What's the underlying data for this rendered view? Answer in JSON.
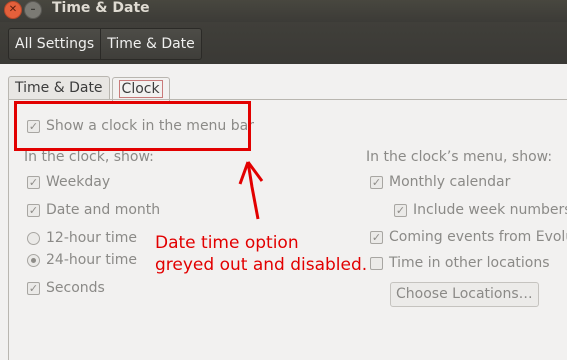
{
  "window": {
    "title": "Time & Date"
  },
  "breadcrumbs": [
    {
      "label": "All Settings"
    },
    {
      "label": "Time & Date"
    }
  ],
  "tabs": [
    {
      "label": "Time & Date"
    },
    {
      "label": "Clock"
    }
  ],
  "clock": {
    "show_clock": {
      "label": "Show a clock in the menu bar",
      "checked": true
    },
    "left_header": "In the clock, show:",
    "weekday": {
      "label": "Weekday",
      "checked": true
    },
    "date_month": {
      "label": "Date and month",
      "checked": true
    },
    "h12": {
      "label": "12-hour time",
      "selected": false
    },
    "h24": {
      "label": "24-hour time",
      "selected": true
    },
    "seconds": {
      "label": "Seconds",
      "checked": true
    },
    "right_header": "In the clock’s menu, show:",
    "monthly_calendar": {
      "label": "Monthly calendar",
      "checked": true
    },
    "week_numbers": {
      "label": "Include week numbers",
      "checked": true
    },
    "coming_events": {
      "label": "Coming events from Evolut",
      "checked": true
    },
    "other_locations": {
      "label": "Time in other locations",
      "checked": false
    },
    "choose_locations": "Choose Locations…"
  },
  "annotation": {
    "line1": "Date time option",
    "line2": "greyed out and disabled.",
    "color": "#e20000"
  }
}
